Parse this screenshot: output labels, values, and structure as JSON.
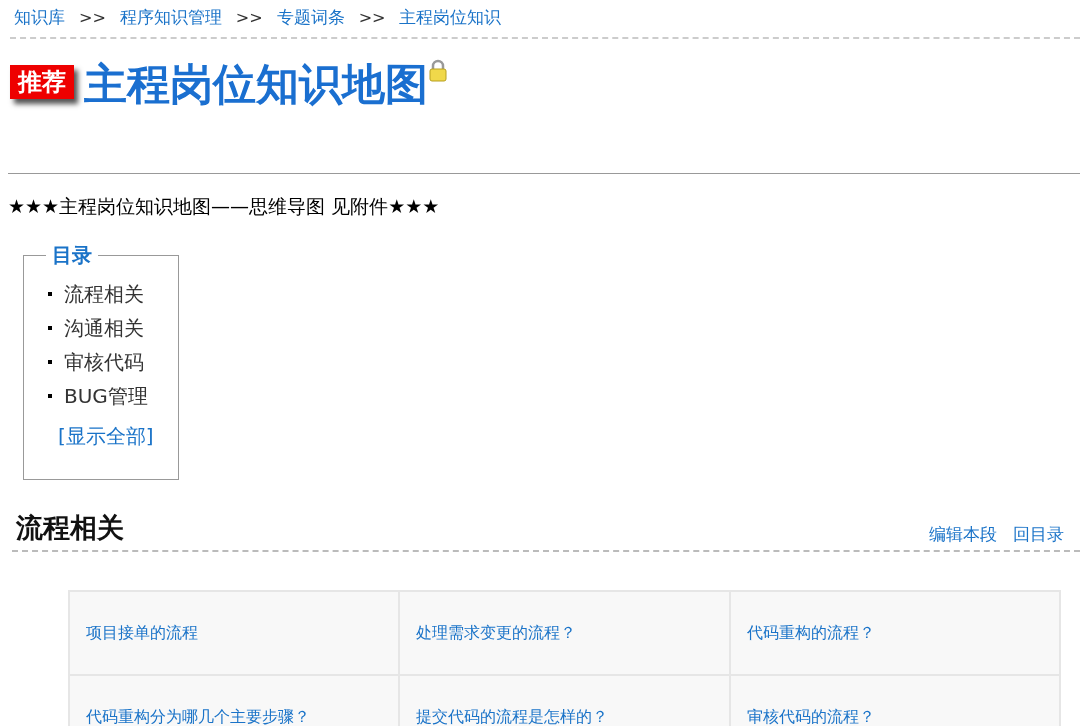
{
  "breadcrumb": [
    {
      "label": "知识库",
      "separator": ">>"
    },
    {
      "label": "程序知识管理",
      "separator": ">>"
    },
    {
      "label": "专题词条",
      "separator": ">>"
    },
    {
      "label": "主程岗位知识"
    }
  ],
  "badge": "推荐",
  "title": "主程岗位知识地图",
  "locked": true,
  "summary": "★★★主程岗位知识地图——思维导图  见附件★★★",
  "toc": {
    "title": "目录",
    "items": [
      "流程相关",
      "沟通相关",
      "审核代码",
      "BUG管理"
    ],
    "show_all": "[显示全部]"
  },
  "section": {
    "title": "流程相关",
    "actions": [
      "编辑本段",
      "回目录"
    ]
  },
  "table": {
    "rows": [
      [
        "项目接单的流程",
        "处理需求变更的流程？",
        "代码重构的流程？"
      ],
      [
        "代码重构分为哪几个主要步骤？",
        "提交代码的流程是怎样的？",
        "审核代码的流程？"
      ]
    ]
  }
}
